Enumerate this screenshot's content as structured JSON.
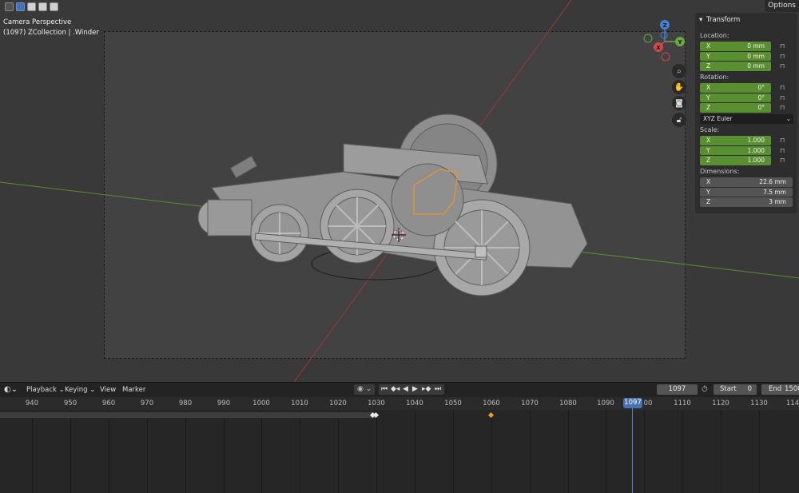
{
  "viewport": {
    "view_title": "Camera Perspective",
    "collection": "(1097) ZCollection | .Winder",
    "options_label": "Options",
    "gizmo": {
      "z": "Z",
      "y": "Y",
      "x": "X"
    }
  },
  "npanel": {
    "header": "Transform",
    "location": {
      "label": "Location:",
      "x": {
        "axis": "X",
        "value": "0 mm"
      },
      "y": {
        "axis": "Y",
        "value": "0 mm"
      },
      "z": {
        "axis": "Z",
        "value": "0 mm"
      }
    },
    "rotation": {
      "label": "Rotation:",
      "x": {
        "axis": "X",
        "value": "0°"
      },
      "y": {
        "axis": "Y",
        "value": "0°"
      },
      "z": {
        "axis": "Z",
        "value": "0°"
      }
    },
    "rotation_mode": "XYZ Euler",
    "scale": {
      "label": "Scale:",
      "x": {
        "axis": "X",
        "value": "1.000"
      },
      "y": {
        "axis": "Y",
        "value": "1.000"
      },
      "z": {
        "axis": "Z",
        "value": "1.000"
      }
    },
    "dimensions": {
      "label": "Dimensions:",
      "x": {
        "axis": "X",
        "value": "22.6 mm"
      },
      "y": {
        "axis": "Y",
        "value": "7.5 mm"
      },
      "z": {
        "axis": "Z",
        "value": "3 mm"
      }
    }
  },
  "timeline": {
    "menus": {
      "playback": "Playback",
      "keying": "Keying",
      "view": "View",
      "marker": "Marker"
    },
    "current_frame": "1097",
    "start_label": "Start",
    "start_value": "0",
    "end_label": "End",
    "end_value": "1500",
    "ruler_ticks": [
      "940",
      "950",
      "960",
      "970",
      "980",
      "990",
      "1000",
      "1010",
      "1020",
      "1030",
      "1040",
      "1050",
      "1060",
      "1070",
      "1080",
      "1090",
      "00",
      "1110",
      "1120",
      "1130",
      "114"
    ],
    "playhead_label": "1097"
  },
  "colors": {
    "accent": "#4772b3",
    "field_green": "#5a8f31",
    "keyframe_white": "#e6e6e6",
    "keyframe_orange": "#f0a020",
    "axis_red": "#d04848",
    "axis_green": "#6aa83c",
    "axis_blue": "#3f82d6"
  }
}
